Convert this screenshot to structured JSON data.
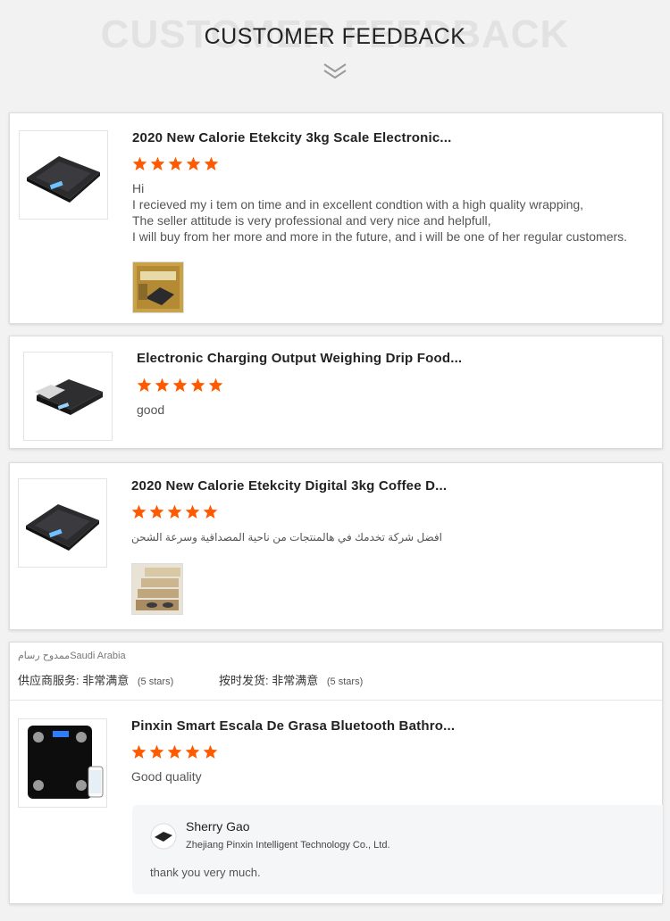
{
  "header": {
    "background_title": "CUSTOMER FEEDBACK",
    "title": "CUSTOMER FEEDBACK"
  },
  "colors": {
    "star": "#ff5a00",
    "page_bg": "#f2f2f2"
  },
  "reviews": [
    {
      "product_title": "2020 New Calorie Etekcity 3kg Scale Electronic...",
      "rating": 5,
      "text": "Hi\nI recieved my i tem on time and in excellent condtion with a high quality wrapping,\nThe seller attitude is very professional and very nice and helpfull,\nI will buy from her more and more in the future, and i will be one of her regular customers.",
      "thumbnail_icon": "kitchen-scale-image",
      "photo_icon": "review-photo-scale-in-box"
    },
    {
      "product_title": "Electronic Charging Output Weighing Drip Food...",
      "rating": 5,
      "text": "good",
      "thumbnail_icon": "drip-scale-image"
    },
    {
      "product_title": "2020 New Calorie Etekcity Digital 3kg Coffee D...",
      "rating": 5,
      "text": "افضل شركة تخدمك في هالمنتجات من ناحية المصداقية وسرعة الشحن",
      "thumbnail_icon": "kitchen-scale-image",
      "photo_icon": "review-photo-boxes"
    },
    {
      "reviewer": "ممدوح رسامSaudi Arabia",
      "supplier_service_label": "供应商服务:",
      "supplier_service_value": "非常满意",
      "supplier_service_stars": "(5 stars)",
      "ontime_label": "按时发货:",
      "ontime_value": "非常满意",
      "ontime_stars": "(5 stars)",
      "product_title": "Pinxin Smart Escala De Grasa Bluetooth Bathro...",
      "rating": 5,
      "text": "Good quality",
      "thumbnail_icon": "bathroom-scale-image",
      "reply": {
        "name": "Sherry Gao",
        "company": "Zhejiang Pinxin Intelligent Technology Co., Ltd.",
        "text": "thank you very much.",
        "avatar_icon": "seller-avatar-icon"
      }
    }
  ]
}
